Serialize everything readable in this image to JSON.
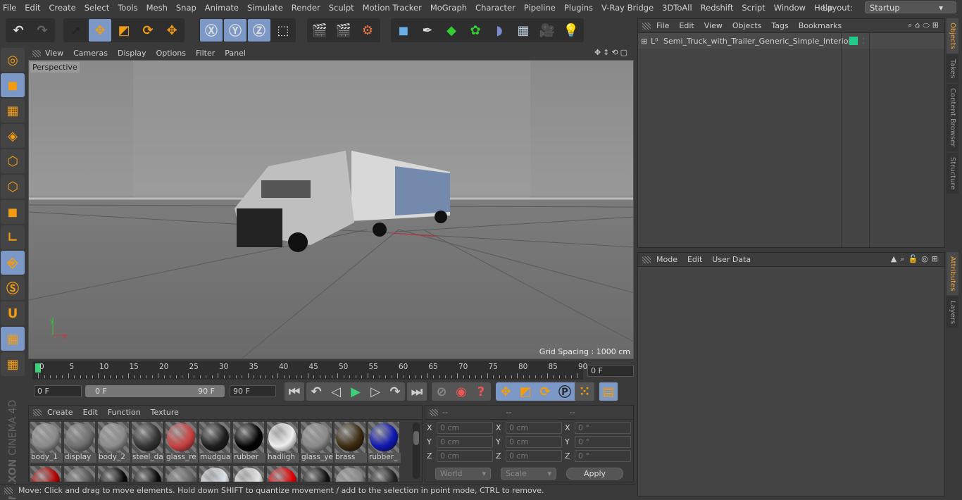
{
  "menubar": {
    "items": [
      "File",
      "Edit",
      "Create",
      "Select",
      "Tools",
      "Mesh",
      "Snap",
      "Animate",
      "Simulate",
      "Render",
      "Sculpt",
      "Motion Tracker",
      "MoGraph",
      "Character",
      "Pipeline",
      "Plugins",
      "V-Ray Bridge",
      "3DToAll",
      "Redshift",
      "Script",
      "Window",
      "Help"
    ],
    "layout_label": "Layout:",
    "layout_value": "Startup"
  },
  "toolbar": {
    "groups": [
      [
        "undo-icon",
        "redo-icon"
      ],
      [
        "live-selection-icon",
        "move-icon",
        "scale-icon",
        "rotate-icon",
        "move-last-icon"
      ],
      [
        "x-axis-icon",
        "y-axis-icon",
        "z-axis-icon",
        "coordinate-system-icon"
      ],
      [
        "render-view-icon",
        "render-picture-viewer-icon",
        "render-settings-icon"
      ],
      [
        "cube-icon",
        "pen-icon",
        "subdivision-icon",
        "cloner-icon",
        "deformer-icon",
        "floor-icon",
        "camera-icon",
        "light-icon"
      ]
    ],
    "axis_labels": [
      "X",
      "Y",
      "Z"
    ]
  },
  "left_toolbar": [
    "make-editable-icon",
    "model-mode-icon",
    "texture-mode-icon",
    "workplane-icon",
    "points-mode-icon",
    "edges-mode-icon",
    "polygons-mode-icon",
    "axis-icon",
    "tweak-icon",
    "snap-icon",
    "magnet-icon",
    "lock-workplane-icon",
    "workplane-align-icon"
  ],
  "viewport": {
    "menu": [
      "View",
      "Cameras",
      "Display",
      "Options",
      "Filter",
      "Panel"
    ],
    "camera_label": "Perspective",
    "grid_spacing": "Grid Spacing : 1000 cm"
  },
  "timeline": {
    "ticks": [
      "0",
      "5",
      "10",
      "15",
      "20",
      "25",
      "30",
      "35",
      "40",
      "45",
      "50",
      "55",
      "60",
      "65",
      "70",
      "75",
      "80",
      "85",
      "90"
    ],
    "current_frame": "0 F",
    "start": "0 F",
    "range_start": "0 F",
    "range_end": "90 F",
    "end": "90 F"
  },
  "materials": {
    "menu": [
      "Create",
      "Edit",
      "Function",
      "Texture"
    ],
    "row1": [
      {
        "name": "body_1",
        "color": "#8a8a8a"
      },
      {
        "name": "display",
        "color": "#6e6e6e"
      },
      {
        "name": "body_2",
        "color": "#8c8c8c"
      },
      {
        "name": "steel_da",
        "color": "#333333"
      },
      {
        "name": "glass_re",
        "color": "#c84040"
      },
      {
        "name": "mudgua",
        "color": "#1e1e1e"
      },
      {
        "name": "rubber",
        "color": "#050505"
      },
      {
        "name": "hadligh",
        "color": "#eeeeee"
      },
      {
        "name": "glass_ye",
        "color": "#8a8a8a"
      },
      {
        "name": "brass",
        "color": "#3a2a10"
      },
      {
        "name": "rubber_",
        "color": "#1018b0"
      }
    ],
    "row2": [
      "#b00000",
      "#555555",
      "#0a0a0a",
      "#0a0a0a",
      "#666666",
      "#dde4ec",
      "#e6e6e6",
      "#e00000",
      "#111111",
      "#8a8a8a",
      "#222222"
    ]
  },
  "coords": {
    "headers": [
      "--",
      "--",
      "--"
    ],
    "rows": [
      {
        "axis": "X",
        "pos": "0 cm",
        "size": "0 cm",
        "rot": "0 °"
      },
      {
        "axis": "Y",
        "pos": "0 cm",
        "size": "0 cm",
        "rot": "0 °"
      },
      {
        "axis": "Z",
        "pos": "0 cm",
        "size": "0 cm",
        "rot": "0 °"
      }
    ],
    "mode": "World",
    "type": "Scale",
    "apply": "Apply"
  },
  "status": "Move: Click and drag to move elements. Hold down SHIFT to quantize movement / add to the selection in point mode, CTRL to remove.",
  "objects": {
    "menu": [
      "File",
      "Edit",
      "View",
      "Objects",
      "Tags",
      "Bookmarks"
    ],
    "items": [
      {
        "name": "Semi_Truck_with_Trailer_Generic_Simple_Interior",
        "tag_color": "#22cc88"
      }
    ]
  },
  "attributes": {
    "menu": [
      "Mode",
      "Edit",
      "User Data"
    ]
  },
  "side_tabs": {
    "top": [
      "Objects",
      "Takes",
      "Content Browser",
      "Structure"
    ],
    "bottom": [
      "Attributes",
      "Layers"
    ]
  },
  "brand": "MAXON CINEMA 4D"
}
